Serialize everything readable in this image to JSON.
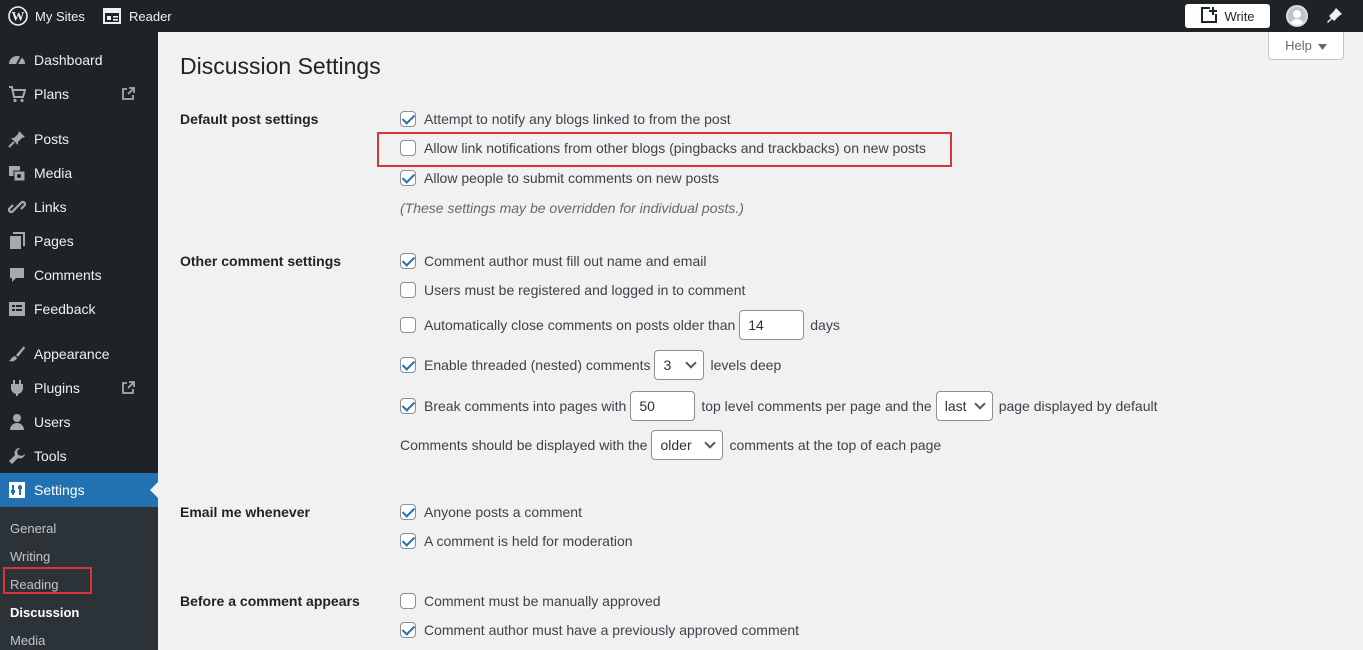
{
  "topbar": {
    "my_sites": "My Sites",
    "reader": "Reader",
    "write": "Write"
  },
  "sidebar": {
    "items": [
      {
        "label": "Dashboard",
        "icon": "dashboard-icon"
      },
      {
        "label": "Plans",
        "icon": "cart-icon",
        "external": true
      },
      {
        "label": "Posts",
        "icon": "pin-icon"
      },
      {
        "label": "Media",
        "icon": "media-icon"
      },
      {
        "label": "Links",
        "icon": "link-icon"
      },
      {
        "label": "Pages",
        "icon": "pages-icon"
      },
      {
        "label": "Comments",
        "icon": "comment-icon"
      },
      {
        "label": "Feedback",
        "icon": "feedback-icon"
      },
      {
        "label": "Appearance",
        "icon": "brush-icon"
      },
      {
        "label": "Plugins",
        "icon": "plugin-icon",
        "external": true
      },
      {
        "label": "Users",
        "icon": "user-icon"
      },
      {
        "label": "Tools",
        "icon": "wrench-icon"
      },
      {
        "label": "Settings",
        "icon": "settings-icon",
        "active": true
      }
    ],
    "submenu": [
      "General",
      "Writing",
      "Reading",
      "Discussion",
      "Media"
    ],
    "current_submenu": "Discussion"
  },
  "help": "Help",
  "page_title": "Discussion Settings",
  "sections": {
    "default_post": {
      "label": "Default post settings",
      "options": [
        {
          "text": "Attempt to notify any blogs linked to from the post",
          "checked": true
        },
        {
          "text": "Allow link notifications from other blogs (pingbacks and trackbacks) on new posts",
          "checked": false
        },
        {
          "text": "Allow people to submit comments on new posts",
          "checked": true
        }
      ],
      "note": "(These settings may be overridden for individual posts.)"
    },
    "other_comment": {
      "label": "Other comment settings",
      "author_fill": {
        "text": "Comment author must fill out name and email",
        "checked": true
      },
      "registered": {
        "text": "Users must be registered and logged in to comment",
        "checked": false
      },
      "auto_close": {
        "text": "Automatically close comments on posts older than",
        "checked": false,
        "value": "14",
        "suffix": "days"
      },
      "threaded": {
        "text": "Enable threaded (nested) comments",
        "checked": true,
        "value": "3",
        "suffix": "levels deep"
      },
      "paged": {
        "text": "Break comments into pages with",
        "checked": true,
        "value": "50",
        "middle": "top level comments per page and the",
        "select": "last",
        "suffix": "page displayed by default"
      },
      "order": {
        "text": "Comments should be displayed with the",
        "select": "older",
        "suffix": "comments at the top of each page"
      }
    },
    "email": {
      "label": "Email me whenever",
      "options": [
        {
          "text": "Anyone posts a comment",
          "checked": true
        },
        {
          "text": "A comment is held for moderation",
          "checked": true
        }
      ]
    },
    "before_appears": {
      "label": "Before a comment appears",
      "options": [
        {
          "text": "Comment must be manually approved",
          "checked": false
        },
        {
          "text": "Comment author must have a previously approved comment",
          "checked": true
        }
      ]
    }
  }
}
